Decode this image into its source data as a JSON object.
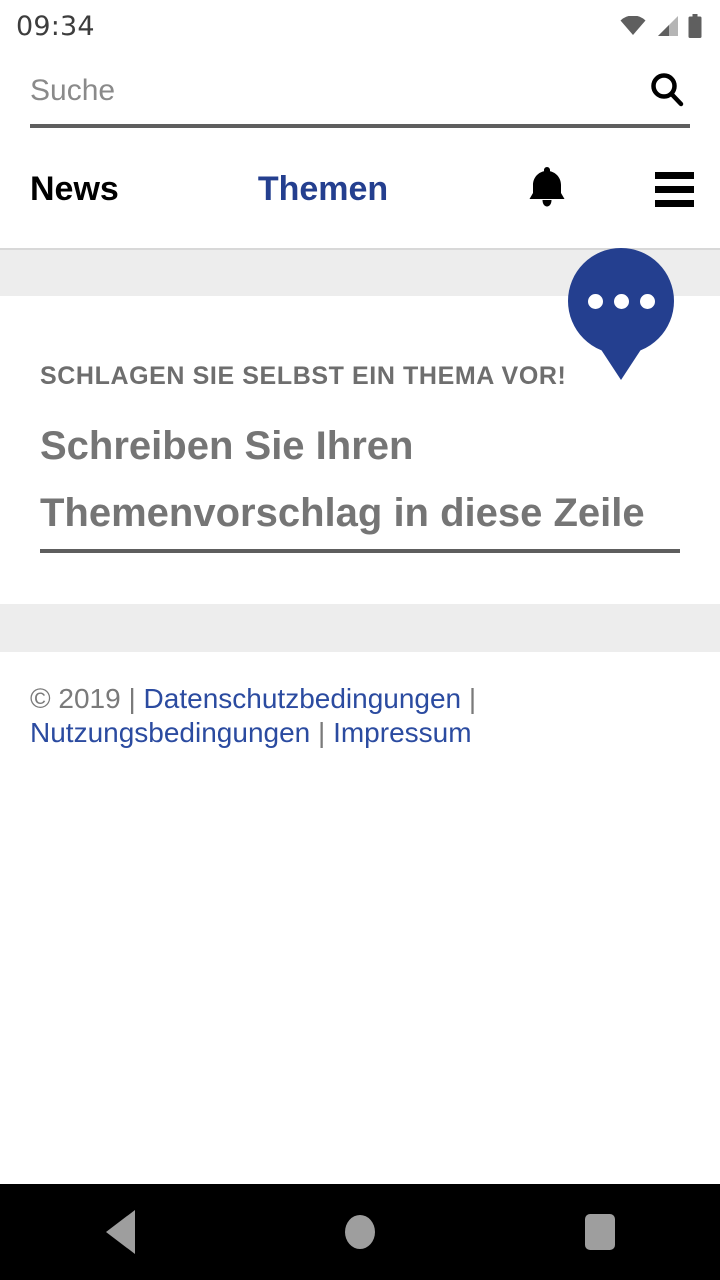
{
  "status_bar": {
    "time": "09:34",
    "icons": [
      "wifi-icon",
      "cellular-signal-icon",
      "battery-icon"
    ]
  },
  "search": {
    "placeholder": "Suche",
    "value": "",
    "icon": "search-icon"
  },
  "main_nav": {
    "news_label": "News",
    "themen_label": "Themen",
    "bell_icon": "notification-bell-icon",
    "menu_icon": "hamburger-menu-icon",
    "active_item": "Themen"
  },
  "suggestion": {
    "bubble_icon": "speech-bubble-ellipsis-icon",
    "kicker": "SCHLAGEN SIE SELBST EIN THEMA VOR!",
    "field_placeholder": "Schreiben Sie Ihren Themenvorschlag in diese Zeile",
    "field_value": ""
  },
  "footer": {
    "copyright": "© 2019",
    "separator": "|",
    "links": [
      {
        "label": "Datenschutzbedingungen"
      },
      {
        "label": "Nutzungsbedingungen"
      },
      {
        "label": "Impressum"
      }
    ]
  },
  "android_nav": {
    "back_label": "back-button",
    "home_label": "home-button",
    "recents_label": "recents-button"
  },
  "colors": {
    "brand_blue": "#243f8f",
    "link_blue": "#2b4ba0",
    "band_gray": "#ededed",
    "text_gray": "#6e6e6e",
    "placeholder_gray": "#757575",
    "nav_bar_black": "#000000"
  }
}
